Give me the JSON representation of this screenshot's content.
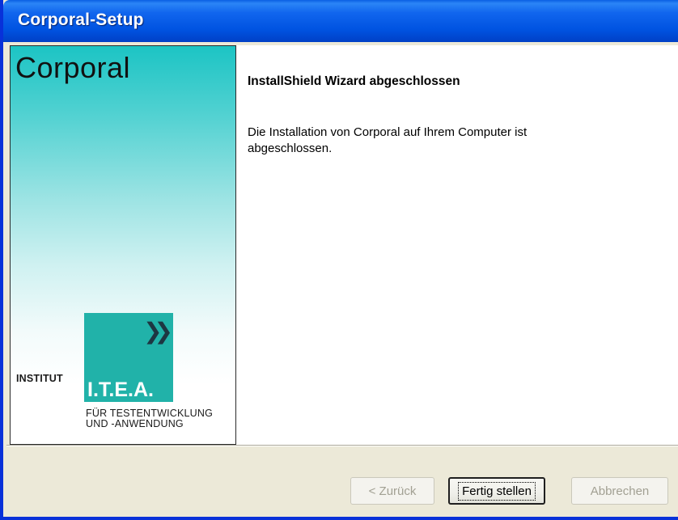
{
  "window": {
    "title": "Corporal-Setup"
  },
  "side_panel": {
    "product_name": "Corporal",
    "logo": {
      "institut_label": "INSTITUT",
      "abbreviation": "I.T.E.A.",
      "subtitle": "FÜR TESTENTWICKLUNG\nUND -ANWENDUNG",
      "box_color": "#21b2a9",
      "arrow_icon": "double-chevron-right"
    }
  },
  "content": {
    "heading": "InstallShield Wizard abgeschlossen",
    "message": "Die Installation von Corporal auf Ihrem Computer ist abgeschlossen."
  },
  "buttons": {
    "back_label": "< Zurück",
    "finish_label": "Fertig stellen",
    "cancel_label": "Abbrechen"
  },
  "colors": {
    "titlebar": "#0053e1",
    "dialog_background": "#ece9d8",
    "panel_gradient_top": "#1cc4c4"
  }
}
